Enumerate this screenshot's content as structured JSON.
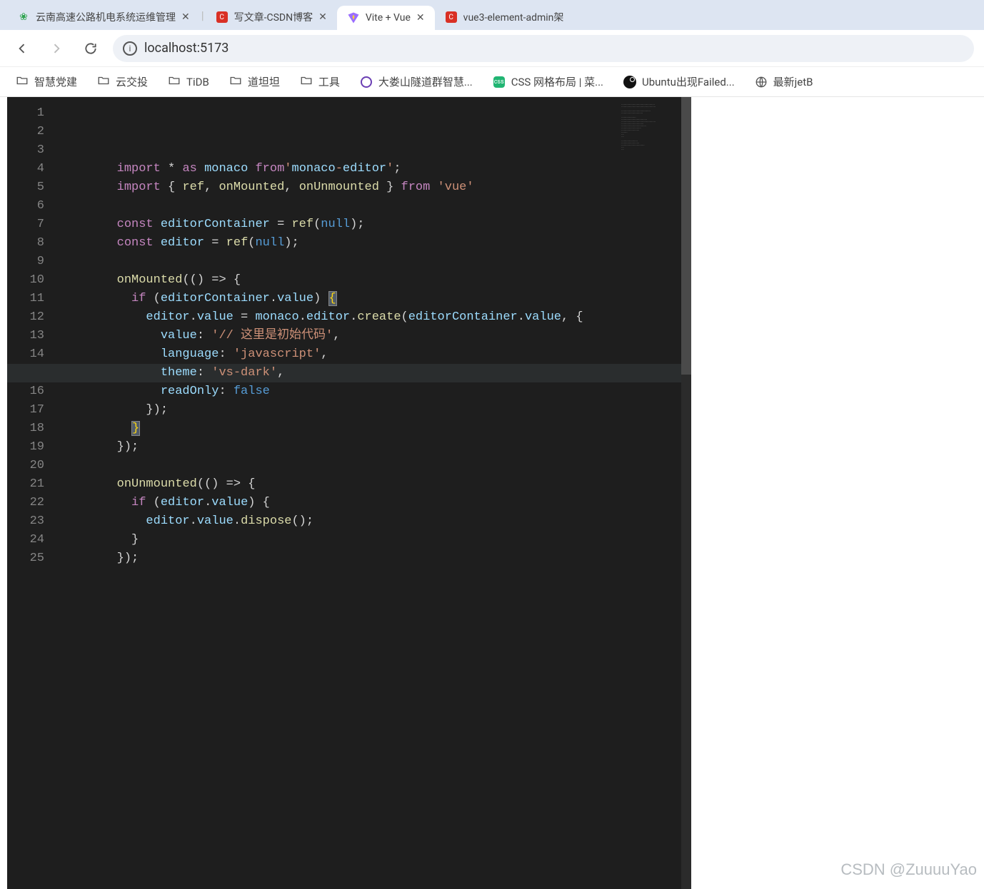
{
  "browser": {
    "tabs": [
      {
        "title": "云南高速公路机电系统运维管理",
        "favicon": "green-leaf"
      },
      {
        "title": "写文章-CSDN博客",
        "favicon": "red-c"
      },
      {
        "title": "Vite + Vue",
        "favicon": "vite",
        "active": true
      },
      {
        "title": "vue3-element-admin架",
        "favicon": "red-c"
      }
    ],
    "address": "localhost:5173",
    "bookmarks": [
      {
        "label": "智慧党建",
        "icon": "folder"
      },
      {
        "label": "云交投",
        "icon": "folder"
      },
      {
        "label": "TiDB",
        "icon": "folder"
      },
      {
        "label": "道坦坦",
        "icon": "folder"
      },
      {
        "label": "工具",
        "icon": "folder"
      },
      {
        "label": "大娄山隧道群智慧...",
        "icon": "circle-blue"
      },
      {
        "label": "CSS 网格布局 | 菜...",
        "icon": "green-badge"
      },
      {
        "label": "Ubuntu出现Failed...",
        "icon": "dark-circle"
      },
      {
        "label": "最新jetB",
        "icon": "globe"
      }
    ]
  },
  "editor": {
    "lineCount": 25,
    "activeLine": 15,
    "lines": [
      "",
      "import * as monaco from'monaco-editor';",
      "import { ref, onMounted, onUnmounted } from 'vue'",
      "",
      "const editorContainer = ref(null);",
      "const editor = ref(null);",
      "",
      "onMounted(() => {",
      "  if (editorContainer.value) {",
      "    editor.value = monaco.editor.create(editorContainer.value, {",
      "      value: '// 这里是初始代码',",
      "      language: 'javascript',",
      "      theme: 'vs-dark',",
      "      readOnly: false",
      "    });",
      "  }",
      "});",
      "",
      "onUnmounted(() => {",
      "  if (editor.value) {",
      "    editor.value.dispose();",
      "  }",
      "});",
      "",
      ""
    ]
  },
  "watermark": "CSDN @ZuuuuYao"
}
